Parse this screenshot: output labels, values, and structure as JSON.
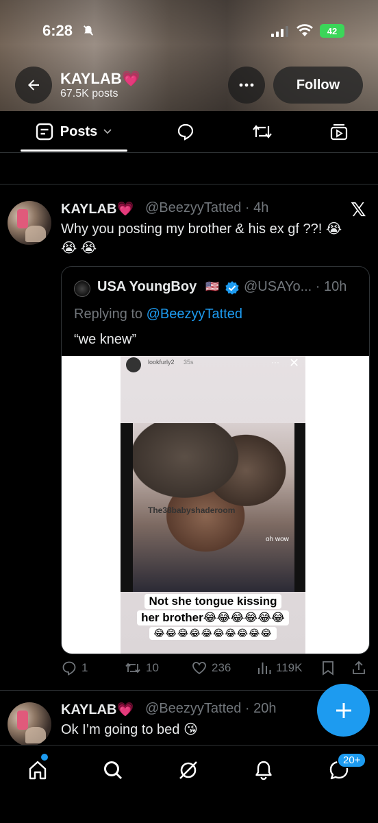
{
  "status_bar": {
    "time": "6:28",
    "battery": "42"
  },
  "header": {
    "name": "KAYLAB",
    "heart": "💗",
    "post_count": "67.5K posts",
    "follow_label": "Follow"
  },
  "tabs": {
    "posts_label": "Posts"
  },
  "tweet1": {
    "name": "KAYLAB",
    "heart": "💗",
    "handle_time": "@BeezyyTatted · 4h",
    "text_line1": "Why you posting my brother & his ex gf ??! 😭",
    "text_line2": "😭 😭",
    "quote": {
      "name": "USA YoungBoy",
      "flag": "🇺🇸",
      "handle_time": "@USAYo... · 10h",
      "replying_prefix": "Replying to ",
      "replying_handle": "@BeezyyTatted",
      "text": "“we knew”",
      "media": {
        "story_user": "lookfurly2",
        "story_time": "35s",
        "watermark": "The38babyshaderoom",
        "overlay": "oh wow",
        "caption_line1": "Not  she tongue kissing",
        "caption_line2": "her brother😂😂😂😂😂😂",
        "caption_line3": "😂😂😂😂😂😂😂😂😂😂"
      }
    },
    "actions": {
      "replies": "1",
      "reposts": "10",
      "likes": "236",
      "views": "119K"
    }
  },
  "tweet2": {
    "name": "KAYLAB",
    "heart": "💗",
    "handle_time": "@BeezyyTatted · 20h",
    "text": "Ok I’m going to bed 😘"
  },
  "bottom_nav": {
    "messages_badge": "20+"
  },
  "colors": {
    "accent": "#1d9bf0",
    "muted": "#71767b",
    "text": "#e7e9ea",
    "divider": "#2f3336"
  }
}
